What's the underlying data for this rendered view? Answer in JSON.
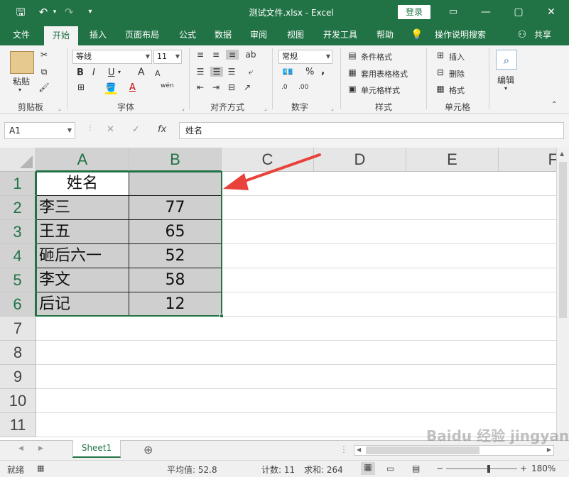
{
  "window": {
    "title": "测试文件.xlsx  -  Excel",
    "login_label": "登录",
    "min_glyph": "—",
    "restore_glyph": "▢",
    "close_glyph": "✕",
    "ribbon_toggle_glyph": "▭"
  },
  "quick_access": {
    "save_glyph": "🖫",
    "undo_glyph": "↶",
    "redo_glyph": "↷",
    "customize_glyph": "▾"
  },
  "tabs": [
    {
      "label": "文件"
    },
    {
      "label": "开始"
    },
    {
      "label": "插入"
    },
    {
      "label": "页面布局"
    },
    {
      "label": "公式"
    },
    {
      "label": "数据"
    },
    {
      "label": "审阅"
    },
    {
      "label": "视图"
    },
    {
      "label": "开发工具"
    },
    {
      "label": "帮助"
    }
  ],
  "tell_me": "操作说明搜索",
  "share": "共享",
  "ribbon": {
    "clipboard": {
      "paste": "粘贴",
      "label": "剪贴板"
    },
    "font": {
      "name": "等线",
      "size": "11",
      "bold": "B",
      "italic": "I",
      "underline": "U",
      "grow": "A",
      "shrink": "A",
      "phonetic": "wén",
      "label": "字体"
    },
    "alignment": {
      "label": "对齐方式"
    },
    "number": {
      "format": "常规",
      "percent": "%",
      "comma": ",",
      "inc": ".0",
      "dec": ".00",
      "label": "数字"
    },
    "styles": {
      "conditional": "条件格式",
      "table": "套用表格格式",
      "cell": "单元格样式",
      "label": "样式"
    },
    "cells": {
      "insert": "插入",
      "delete": "删除",
      "format": "格式",
      "label": "单元格"
    },
    "editing": {
      "label": "编辑"
    }
  },
  "formula_bar": {
    "name_box": "A1",
    "cancel": "✕",
    "enter": "✓",
    "fx": "fx",
    "value": "姓名"
  },
  "grid": {
    "columns": [
      "A",
      "B",
      "C",
      "D",
      "E",
      "F"
    ],
    "rows": [
      "1",
      "2",
      "3",
      "4",
      "5",
      "6",
      "7",
      "8",
      "9",
      "10",
      "11"
    ],
    "header_row": {
      "a": "姓名",
      "b": ""
    },
    "data_rows": [
      {
        "name": "李三",
        "score": "77"
      },
      {
        "name": "王五",
        "score": "65"
      },
      {
        "name": "砸后六一",
        "score": "52"
      },
      {
        "name": "李文",
        "score": "58"
      },
      {
        "name": "后记",
        "score": "12"
      }
    ]
  },
  "sheets": {
    "active": "Sheet1",
    "add": "⊕"
  },
  "status": {
    "mode": "就绪",
    "average": "平均值: 52.8",
    "count": "计数: 11",
    "sum": "求和: 264",
    "zoom": "180%",
    "zoom_minus": "−",
    "zoom_plus": "+"
  },
  "watermark": "Baidu 经验 jingyan.baidu.com",
  "colors": {
    "brand": "#217346",
    "selection_fill": "#cfcfcf",
    "arrow": "#e8423b"
  }
}
